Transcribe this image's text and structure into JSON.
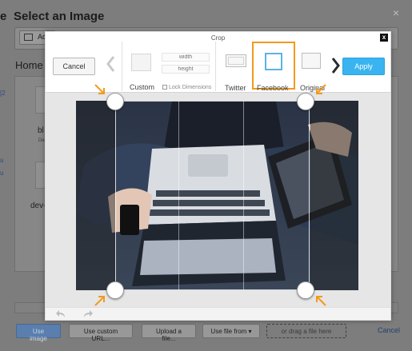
{
  "background": {
    "title": "Select an Image",
    "title_left_fragment": "e",
    "close_glyph": "×",
    "actions_button": "Acti",
    "breadcrumb": "Home /",
    "items": [
      {
        "label": "bl",
        "sub": "De"
      },
      {
        "label": "dev-h",
        "sub": ""
      }
    ],
    "side_fragments": [
      "[2",
      "u",
      "u"
    ],
    "buttons": {
      "use_image": "Use image",
      "use_custom_url": "Use custom URL...",
      "upload_file": "Upload a file...",
      "use_file_from": "Use file from ▾",
      "drag_file": "or drag a file here",
      "cancel": "Cancel"
    }
  },
  "crop": {
    "title": "Crop",
    "close_glyph": "x",
    "cancel_label": "Cancel",
    "apply_label": "Apply",
    "custom_label": "Custom",
    "width_placeholder": "width",
    "height_placeholder": "height",
    "lock_label": "Lock Dimensions",
    "presets": [
      {
        "label": "Twitter",
        "selected": false
      },
      {
        "label": "Facebook",
        "selected": true
      },
      {
        "label": "Original",
        "selected": false
      }
    ],
    "highlight_color": "#f29a1b",
    "apply_color": "#39b4f0",
    "selected_swatch_color": "#5cb3e6"
  }
}
